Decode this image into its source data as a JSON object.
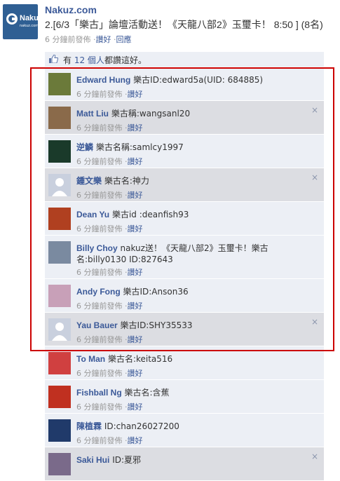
{
  "page": {
    "name": "Nakuz.com",
    "logo_text": "Nakuz",
    "logo_subtext": "nakuz.com",
    "post_text": "2.[6/3「樂古」論壇活動送！《天龍八部2》玉璽卡！ 8:50 ] (8名)",
    "post_time": "6 分鐘前發佈",
    "like_link": "讚好",
    "reply_link": "回應",
    "separator": "·"
  },
  "likes": {
    "prefix": "有",
    "count_link": "12 個人",
    "suffix": "都讚這好。",
    "icon": "thumbs-up-icon"
  },
  "comments": [
    {
      "author": "Edward Hung",
      "text": "樂古ID:edward5a(UID: 684885)",
      "time": "6 分鐘前發佈",
      "like": "讚好",
      "avatar_color": "#6b7a3a",
      "hover": false
    },
    {
      "author": "Matt Liu",
      "text": "樂古稱:wangsanl20",
      "time": "6 分鐘前發佈",
      "like": "讚好",
      "avatar_color": "#8a6a4a",
      "hover": true,
      "close": "×"
    },
    {
      "author": "逆鱗",
      "text": "樂古名稱:samlcy1997",
      "time": "6 分鐘前發佈",
      "like": "讚好",
      "avatar_color": "#1a3a2a",
      "hover": false
    },
    {
      "author": "鍾文樂",
      "text": "樂古名:神力",
      "time": "6 分鐘前發佈",
      "like": "讚好",
      "avatar_color": "#c9d0de",
      "hover": true,
      "close": "×"
    },
    {
      "author": "Dean Yu",
      "text": "樂古id :deanfish93",
      "time": "6 分鐘前發佈",
      "like": "讚好",
      "avatar_color": "#b04020",
      "hover": false
    },
    {
      "author": "Billy Choy",
      "text": "nakuz送！《天龍八部2》玉璽卡！樂古名:billy0130 ID:827643",
      "time": "6 分鐘前發佈",
      "like": "讚好",
      "avatar_color": "#7a8aa0",
      "hover": false
    },
    {
      "author": "Andy Fong",
      "text": "樂古ID:Anson36",
      "time": "6 分鐘前發佈",
      "like": "讚好",
      "avatar_color": "#c8a0b8",
      "hover": false
    },
    {
      "author": "Yau Bauer",
      "text": "樂古ID:SHY35533",
      "time": "6 分鐘前發佈",
      "like": "讚好",
      "avatar_color": "#c9d0de",
      "hover": true,
      "close": "×"
    },
    {
      "author": "To Man",
      "text": "樂古名:keita516",
      "time": "6 分鐘前發佈",
      "like": "讚好",
      "avatar_color": "#d04040",
      "hover": false
    },
    {
      "author": "Fishball Ng",
      "text": "樂古名:含蕉",
      "time": "6 分鐘前發佈",
      "like": "讚好",
      "avatar_color": "#c03020",
      "hover": false
    },
    {
      "author": "陳植霖",
      "text": "ID:chan26027200",
      "time": "6 分鐘前發佈",
      "like": "讚好",
      "avatar_color": "#203a6a",
      "hover": false
    },
    {
      "author": "Saki Hui",
      "text": "ID:夏邪",
      "time": "",
      "like": "",
      "avatar_color": "#7a6a8a",
      "hover": true,
      "close": "×"
    }
  ],
  "colors": {
    "link": "#3b5998",
    "highlight": "#cc0000",
    "comment_bg": "#eceff5"
  }
}
